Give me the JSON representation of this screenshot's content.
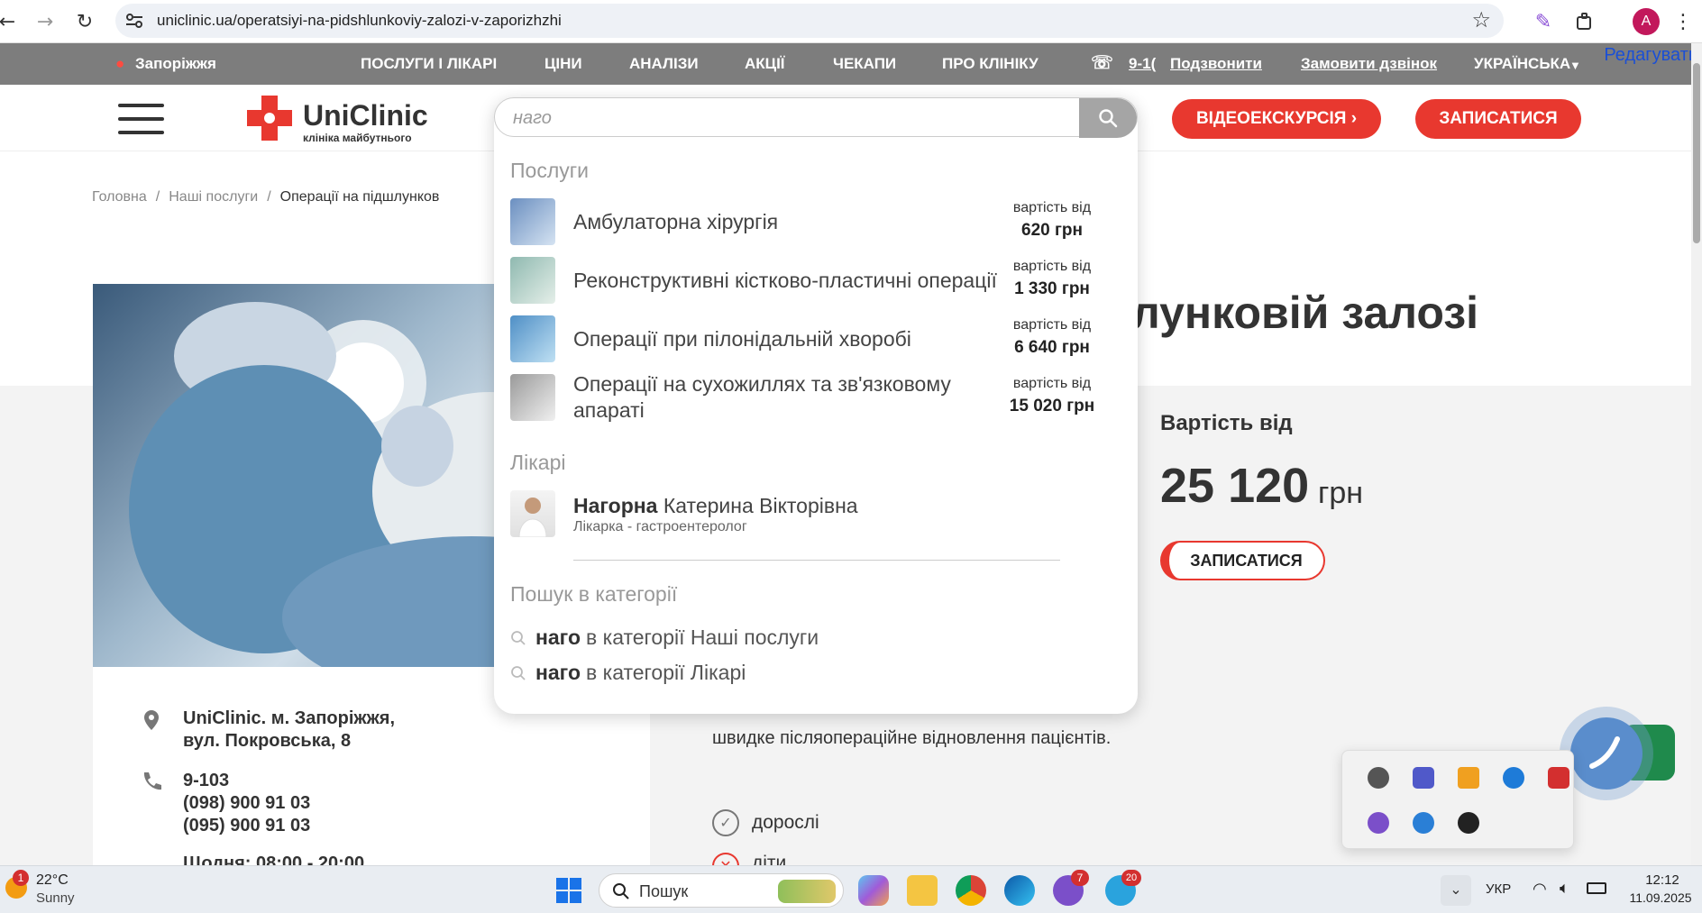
{
  "browser": {
    "url": "uniclinic.ua/operatsiyi-na-pidshlunkoviy-zalozi-v-zaporizhzhi",
    "avatar_letter": "A"
  },
  "topbar": {
    "city": "Запоріжжя",
    "nav": [
      "ПОСЛУГИ І ЛІКАРІ",
      "ЦІНИ",
      "АНАЛІЗИ",
      "АКЦІЇ",
      "ЧЕКАПИ",
      "ПРО КЛІНІКУ"
    ],
    "phone_short": "9-1(",
    "call": "Подзвонити",
    "order_call": "Замовити дзвінок",
    "language": "УКРАЇНСЬКА",
    "edit": "Редагувати"
  },
  "header": {
    "logo_name": "UniClinic",
    "logo_tagline": "клініка майбутнього",
    "video_tour": "ВІДЕОЕКСКУРСІЯ ›",
    "book": "ЗАПИСАТИСЯ"
  },
  "breadcrumb": {
    "home": "Головна",
    "services": "Наші послуги",
    "current": "Операції на підшлунков"
  },
  "page": {
    "title_visible": "лунковій залозі",
    "price_label": "Вартість від",
    "price_value": "25 120",
    "price_currency": "грн",
    "book_button": "ЗАПИСАТИСЯ",
    "description": "швидке післяопераційне відновлення пацієнтів.",
    "check_adults": "дорослі",
    "check_children": "діти"
  },
  "contacts": {
    "address_line1": "UniClinic. м. Запоріжжя,",
    "address_line2": "вул. Покровська, 8",
    "phone1": "9-103",
    "phone2": "(098) 900 91 03",
    "phone3": "(095) 900 91 03",
    "hours": "Щодня: 08:00 - 20:00"
  },
  "search": {
    "query": "наго",
    "services_title": "Послуги",
    "price_from_label": "вартість від",
    "services": [
      {
        "name": "Амбулаторна хірургія",
        "price": "620 грн"
      },
      {
        "name": "Реконструктивні кістково-пластичні операції",
        "price": "1 330 грн"
      },
      {
        "name": "Операції при пілонідальній хворобі",
        "price": "6 640 грн"
      },
      {
        "name": "Операції на сухожиллях та зв'язковому апараті",
        "price": "15 020 грн"
      }
    ],
    "doctors_title": "Лікарі",
    "doctor": {
      "surname": "Нагорна",
      "given": "Катерина Вікторівна",
      "role": "Лікарка - гастроентеролог"
    },
    "category_title": "Пошук в категорії",
    "categories": [
      {
        "query": "наго",
        "text": "в категорії Наші послуги"
      },
      {
        "query": "наго",
        "text": "в категорії Лікарі"
      }
    ]
  },
  "taskbar": {
    "weather_temp": "22°C",
    "weather_desc": "Sunny",
    "weather_badge": "1",
    "search_label": "Пошук",
    "lang": "УКР",
    "time": "12:12",
    "date": "11.09.2025",
    "viber_badge": "7",
    "telegram_badge": "20"
  },
  "colors": {
    "brand_red": "#e8382f",
    "topbar_grey": "#7d7d7d"
  }
}
